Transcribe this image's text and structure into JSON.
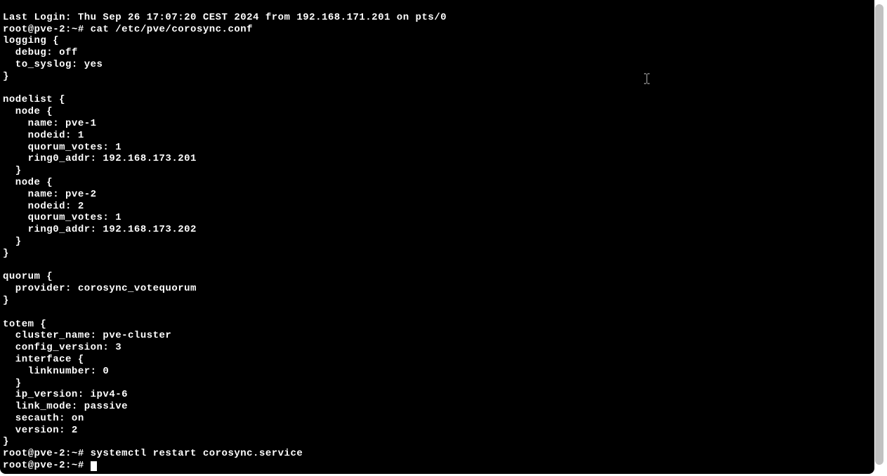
{
  "terminal": {
    "lines": [
      "Last Login: Thu Sep 26 17:07:20 CEST 2024 from 192.168.171.201 on pts/0",
      "root@pve-2:~# cat /etc/pve/corosync.conf",
      "logging {",
      "  debug: off",
      "  to_syslog: yes",
      "}",
      "",
      "nodelist {",
      "  node {",
      "    name: pve-1",
      "    nodeid: 1",
      "    quorum_votes: 1",
      "    ring0_addr: 192.168.173.201",
      "  }",
      "  node {",
      "    name: pve-2",
      "    nodeid: 2",
      "    quorum_votes: 1",
      "    ring0_addr: 192.168.173.202",
      "  }",
      "}",
      "",
      "quorum {",
      "  provider: corosync_votequorum",
      "}",
      "",
      "totem {",
      "  cluster_name: pve-cluster",
      "  config_version: 3",
      "  interface {",
      "    linknumber: 0",
      "  }",
      "  ip_version: ipv4-6",
      "  link_mode: passive",
      "  secauth: on",
      "  version: 2",
      "}",
      "root@pve-2:~# systemctl restart corosync.service",
      "root@pve-2:~# "
    ],
    "prompt": "root@pve-2:~#",
    "hostname": "pve-2",
    "user": "root",
    "commands": {
      "cat": "cat /etc/pve/corosync.conf",
      "restart": "systemctl restart corosync.service"
    },
    "config": {
      "logging": {
        "debug": "off",
        "to_syslog": "yes"
      },
      "nodelist": [
        {
          "name": "pve-1",
          "nodeid": 1,
          "quorum_votes": 1,
          "ring0_addr": "192.168.173.201"
        },
        {
          "name": "pve-2",
          "nodeid": 2,
          "quorum_votes": 1,
          "ring0_addr": "192.168.173.202"
        }
      ],
      "quorum": {
        "provider": "corosync_votequorum"
      },
      "totem": {
        "cluster_name": "pve-cluster",
        "config_version": 3,
        "interface": {
          "linknumber": 0
        },
        "ip_version": "ipv4-6",
        "link_mode": "passive",
        "secauth": "on",
        "version": 2
      }
    }
  }
}
